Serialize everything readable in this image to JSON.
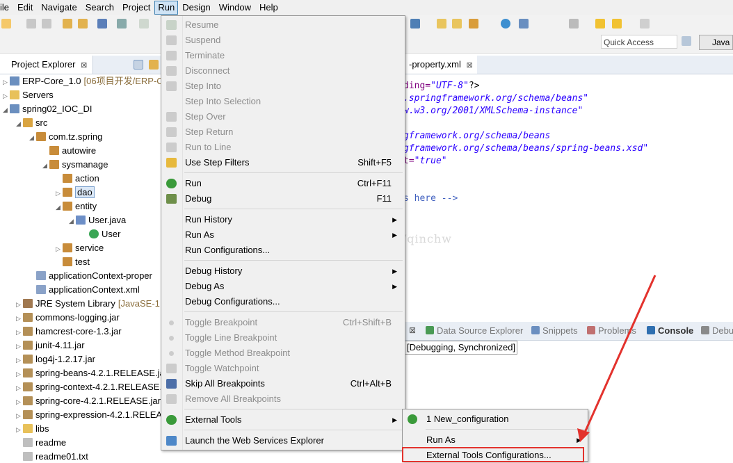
{
  "menubar": {
    "items": [
      "ile",
      "Edit",
      "Navigate",
      "Search",
      "Project",
      "Run",
      "Design",
      "Window",
      "Help"
    ],
    "active_index": 5
  },
  "toolbar": {
    "quick_access": "Quick Access",
    "perspective": "Java"
  },
  "project_explorer": {
    "tab_title": "Project Explorer",
    "tab_close": "⊠",
    "tree": [
      {
        "indent": 0,
        "twisty": "▷",
        "icon": "project-icon",
        "label": "ERP-Core_1.0",
        "extra": "[06项目开发/ERP-Co"
      },
      {
        "indent": 0,
        "twisty": "▷",
        "icon": "folder-icon",
        "label": "Servers",
        "extra": ""
      },
      {
        "indent": 0,
        "twisty": "◢",
        "icon": "project-icon",
        "label": "spring02_IOC_DI",
        "extra": ""
      },
      {
        "indent": 1,
        "twisty": "◢",
        "icon": "source-folder-icon",
        "label": "src",
        "extra": ""
      },
      {
        "indent": 2,
        "twisty": "◢",
        "icon": "package-icon",
        "label": "com.tz.spring",
        "extra": ""
      },
      {
        "indent": 3,
        "twisty": "",
        "icon": "package-icon",
        "label": "autowire",
        "extra": ""
      },
      {
        "indent": 3,
        "twisty": "◢",
        "icon": "package-icon",
        "label": "sysmanage",
        "extra": ""
      },
      {
        "indent": 4,
        "twisty": "",
        "icon": "package-icon",
        "label": "action",
        "extra": ""
      },
      {
        "indent": 4,
        "twisty": "▷",
        "icon": "package-icon",
        "label": "dao",
        "extra": ""
      },
      {
        "indent": 4,
        "twisty": "◢",
        "icon": "package-icon",
        "label": "entity",
        "extra": ""
      },
      {
        "indent": 5,
        "twisty": "◢",
        "icon": "java-file-icon",
        "label": "User.java",
        "extra": ""
      },
      {
        "indent": 6,
        "twisty": "",
        "icon": "class-icon",
        "label": "User",
        "extra": ""
      },
      {
        "indent": 4,
        "twisty": "▷",
        "icon": "package-icon",
        "label": "service",
        "extra": ""
      },
      {
        "indent": 4,
        "twisty": "",
        "icon": "package-icon",
        "label": "test",
        "extra": ""
      },
      {
        "indent": 2,
        "twisty": "",
        "icon": "xml-file-icon",
        "label": "applicationContext-proper",
        "extra": ""
      },
      {
        "indent": 2,
        "twisty": "",
        "icon": "xml-file-icon",
        "label": "applicationContext.xml",
        "extra": ""
      },
      {
        "indent": 1,
        "twisty": "▷",
        "icon": "library-icon",
        "label": "JRE System Library",
        "extra": "[JavaSE-1.7"
      },
      {
        "indent": 1,
        "twisty": "▷",
        "icon": "jar-icon",
        "label": "commons-logging.jar",
        "extra": ""
      },
      {
        "indent": 1,
        "twisty": "▷",
        "icon": "jar-icon",
        "label": "hamcrest-core-1.3.jar",
        "extra": ""
      },
      {
        "indent": 1,
        "twisty": "▷",
        "icon": "jar-icon",
        "label": "junit-4.11.jar",
        "extra": ""
      },
      {
        "indent": 1,
        "twisty": "▷",
        "icon": "jar-icon",
        "label": "log4j-1.2.17.jar",
        "extra": ""
      },
      {
        "indent": 1,
        "twisty": "▷",
        "icon": "jar-icon",
        "label": "spring-beans-4.2.1.RELEASE.ja",
        "extra": ""
      },
      {
        "indent": 1,
        "twisty": "▷",
        "icon": "jar-icon",
        "label": "spring-context-4.2.1.RELEASE.j",
        "extra": ""
      },
      {
        "indent": 1,
        "twisty": "▷",
        "icon": "jar-icon",
        "label": "spring-core-4.2.1.RELEASE.jar",
        "extra": ""
      },
      {
        "indent": 1,
        "twisty": "▷",
        "icon": "jar-icon",
        "label": "spring-expression-4.2.1.RELEA",
        "extra": ""
      },
      {
        "indent": 1,
        "twisty": "▷",
        "icon": "folder-icon",
        "label": "libs",
        "extra": ""
      },
      {
        "indent": 1,
        "twisty": "",
        "icon": "file-icon",
        "label": "readme",
        "extra": ""
      },
      {
        "indent": 1,
        "twisty": "",
        "icon": "file-icon",
        "label": "readme01.txt",
        "extra": ""
      }
    ],
    "selected_label": "dao"
  },
  "editor": {
    "tab_title": "-property.xml",
    "tab_close": "⊠",
    "lines": [
      {
        "parts": [
          {
            "t": "ding=",
            "c": "att"
          },
          {
            "t": "\"UTF-8\"",
            "c": "str"
          },
          {
            "t": "?>",
            "c": ""
          }
        ]
      },
      {
        "parts": [
          {
            "t": ".springframework.org/schema/beans\"",
            "c": "str"
          }
        ]
      },
      {
        "parts": [
          {
            "t": "w.w3.org/2001/XMLSchema-instance\"",
            "c": "str"
          }
        ]
      },
      {
        "parts": [
          {
            "t": "",
            "c": ""
          }
        ]
      },
      {
        "parts": [
          {
            "t": "gframework.org/schema/beans",
            "c": "str"
          }
        ]
      },
      {
        "parts": [
          {
            "t": "gframework.org/schema/beans/spring-beans.xsd\"",
            "c": "str"
          }
        ]
      },
      {
        "parts": [
          {
            "t": "t=",
            "c": "att"
          },
          {
            "t": "\"true\"",
            "c": "str"
          }
        ]
      },
      {
        "parts": [
          {
            "t": "",
            "c": ""
          }
        ]
      },
      {
        "parts": [
          {
            "t": "",
            "c": ""
          }
        ]
      },
      {
        "parts": [
          {
            "t": "s here -->",
            "c": "cmt"
          }
        ]
      }
    ],
    "watermark": "http://blog.csdn.net/qinchw"
  },
  "console": {
    "tabs": [
      "Data Source Explorer",
      "Snippets",
      "Problems",
      "Console",
      "Debu"
    ],
    "status_line": "[Debugging, Synchronized]"
  },
  "run_menu": {
    "items": [
      {
        "label": "Resume",
        "accel": "",
        "submenu": false,
        "disabled": true,
        "icon": "resume-icon"
      },
      {
        "label": "Suspend",
        "accel": "",
        "submenu": false,
        "disabled": true,
        "icon": "suspend-icon"
      },
      {
        "label": "Terminate",
        "accel": "",
        "submenu": false,
        "disabled": true,
        "icon": "terminate-icon"
      },
      {
        "label": "Disconnect",
        "accel": "",
        "submenu": false,
        "disabled": true,
        "icon": "disconnect-icon"
      },
      {
        "label": "Step Into",
        "accel": "",
        "submenu": false,
        "disabled": true,
        "icon": "step-into-icon"
      },
      {
        "label": "Step Into Selection",
        "accel": "",
        "submenu": false,
        "disabled": true,
        "icon": ""
      },
      {
        "label": "Step Over",
        "accel": "",
        "submenu": false,
        "disabled": true,
        "icon": "step-over-icon"
      },
      {
        "label": "Step Return",
        "accel": "",
        "submenu": false,
        "disabled": true,
        "icon": "step-return-icon"
      },
      {
        "label": "Run to Line",
        "accel": "",
        "submenu": false,
        "disabled": true,
        "icon": "run-to-line-icon"
      },
      {
        "label": "Use Step Filters",
        "accel": "Shift+F5",
        "submenu": false,
        "disabled": false,
        "icon": "step-filters-icon"
      },
      {
        "sep": true
      },
      {
        "label": "Run",
        "accel": "Ctrl+F11",
        "submenu": false,
        "disabled": false,
        "icon": "run-icon"
      },
      {
        "label": "Debug",
        "accel": "F11",
        "submenu": false,
        "disabled": false,
        "icon": "debug-icon"
      },
      {
        "sep": true
      },
      {
        "label": "Run History",
        "accel": "",
        "submenu": true,
        "disabled": false,
        "icon": ""
      },
      {
        "label": "Run As",
        "accel": "",
        "submenu": true,
        "disabled": false,
        "icon": ""
      },
      {
        "label": "Run Configurations...",
        "accel": "",
        "submenu": false,
        "disabled": false,
        "icon": ""
      },
      {
        "sep": true
      },
      {
        "label": "Debug History",
        "accel": "",
        "submenu": true,
        "disabled": false,
        "icon": ""
      },
      {
        "label": "Debug As",
        "accel": "",
        "submenu": true,
        "disabled": false,
        "icon": ""
      },
      {
        "label": "Debug Configurations...",
        "accel": "",
        "submenu": false,
        "disabled": false,
        "icon": ""
      },
      {
        "sep": true
      },
      {
        "label": "Toggle Breakpoint",
        "accel": "Ctrl+Shift+B",
        "submenu": false,
        "disabled": true,
        "icon": "breakpoint-icon"
      },
      {
        "label": "Toggle Line Breakpoint",
        "accel": "",
        "submenu": false,
        "disabled": true,
        "icon": "breakpoint-icon"
      },
      {
        "label": "Toggle Method Breakpoint",
        "accel": "",
        "submenu": false,
        "disabled": true,
        "icon": "breakpoint-icon"
      },
      {
        "label": "Toggle Watchpoint",
        "accel": "",
        "submenu": false,
        "disabled": true,
        "icon": "watchpoint-icon"
      },
      {
        "label": "Skip All Breakpoints",
        "accel": "Ctrl+Alt+B",
        "submenu": false,
        "disabled": false,
        "icon": "skip-breakpoints-icon"
      },
      {
        "label": "Remove All Breakpoints",
        "accel": "",
        "submenu": false,
        "disabled": true,
        "icon": "remove-breakpoints-icon"
      },
      {
        "sep": true
      },
      {
        "label": "External Tools",
        "accel": "",
        "submenu": true,
        "disabled": false,
        "icon": "external-tools-icon"
      },
      {
        "sep": true
      },
      {
        "label": "Launch the Web Services Explorer",
        "accel": "",
        "submenu": false,
        "disabled": false,
        "icon": "web-services-icon"
      }
    ]
  },
  "external_tools_submenu": {
    "items": [
      {
        "label": "1 New_configuration",
        "submenu": false,
        "icon": "external-tool-run-icon"
      },
      {
        "sep": true
      },
      {
        "label": "Run As",
        "submenu": true,
        "icon": ""
      },
      {
        "label": "External Tools Configurations...",
        "submenu": false,
        "icon": ""
      }
    ]
  },
  "colors": {
    "highlight_red": "#e3322d",
    "selection_border": "#3c7fb1",
    "xml_string": "#2a00ff",
    "xml_comment": "#3f5fbf"
  }
}
